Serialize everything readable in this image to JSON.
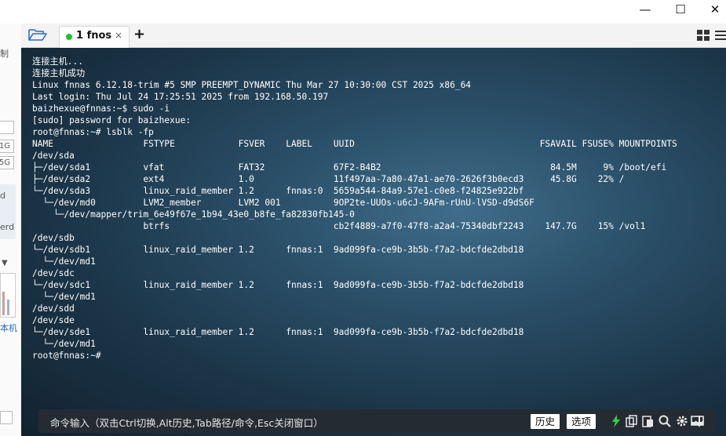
{
  "window": {
    "minimize_label": "—",
    "maximize_label": "☐",
    "close_label": "✕"
  },
  "tabs": [
    {
      "label": "1  fnos",
      "status_color": "#1fbf3a",
      "active": true
    }
  ],
  "tab_close_label": "×",
  "add_tab_label": "+",
  "left_strip": {
    "texts": [
      "制",
      "1G",
      "5G",
      "d",
      "erd",
      "本机"
    ]
  },
  "terminal": {
    "lines": [
      "连接主机...",
      "连接主机成功",
      "Linux fnnas 6.12.18-trim #5 SMP PREEMPT_DYNAMIC Thu Mar 27 10:30:00 CST 2025 x86_64",
      "Last login: Thu Jul 24 17:25:51 2025 from 192.168.50.197",
      "baizhexue@fnnas:~$ sudo -i",
      "[sudo] password for baizhexue:",
      "root@fnnas:~# lsblk -fp",
      "NAME                 FSTYPE            FSVER    LABEL    UUID                                   FSAVAIL FSUSE% MOUNTPOINTS",
      "/dev/sda",
      "├─/dev/sda1          vfat              FAT32             67F2-B4B2                                84.5M     9% /boot/efi",
      "├─/dev/sda2          ext4              1.0               11f497aa-7a80-47a1-ae70-2626f3b0ecd3     45.8G    22% /",
      "└─/dev/sda3          linux_raid_member 1.2      fnnas:0  5659a544-84a9-57e1-c0e8-f24825e922bf",
      "  └─/dev/md0         LVM2_member       LVM2 001          9OP2te-UUOs-u6cJ-9AFm-rUnU-lVSD-d9dS6F",
      "    └─/dev/mapper/trim_6e49f67e_1b94_43e0_b8fe_fa82830fb145-0",
      "                     btrfs                               cb2f4889-a7f0-47f8-a2a4-75340dbf2243    147.7G    15% /vol1",
      "/dev/sdb",
      "└─/dev/sdb1          linux_raid_member 1.2      fnnas:1  9ad099fa-ce9b-3b5b-f7a2-bdcfde2dbd18",
      "  └─/dev/md1",
      "/dev/sdc",
      "└─/dev/sdc1          linux_raid_member 1.2      fnnas:1  9ad099fa-ce9b-3b5b-f7a2-bdcfde2dbd18",
      "  └─/dev/md1",
      "/dev/sdd",
      "/dev/sde",
      "└─/dev/sde1          linux_raid_member 1.2      fnnas:1  9ad099fa-ce9b-3b5b-f7a2-bdcfde2dbd18",
      "  └─/dev/md1",
      "root@fnnas:~#"
    ]
  },
  "command_bar": {
    "hint": "命令输入（双击Ctrl切换,Alt历史,Tab路径/命令,Esc关闭窗口）",
    "history_label": "历史",
    "options_label": "选项"
  },
  "colors": {
    "terminal_bg": "#2b5069",
    "command_bar_bg": "#252b33",
    "accent_green": "#1fbf3a"
  }
}
